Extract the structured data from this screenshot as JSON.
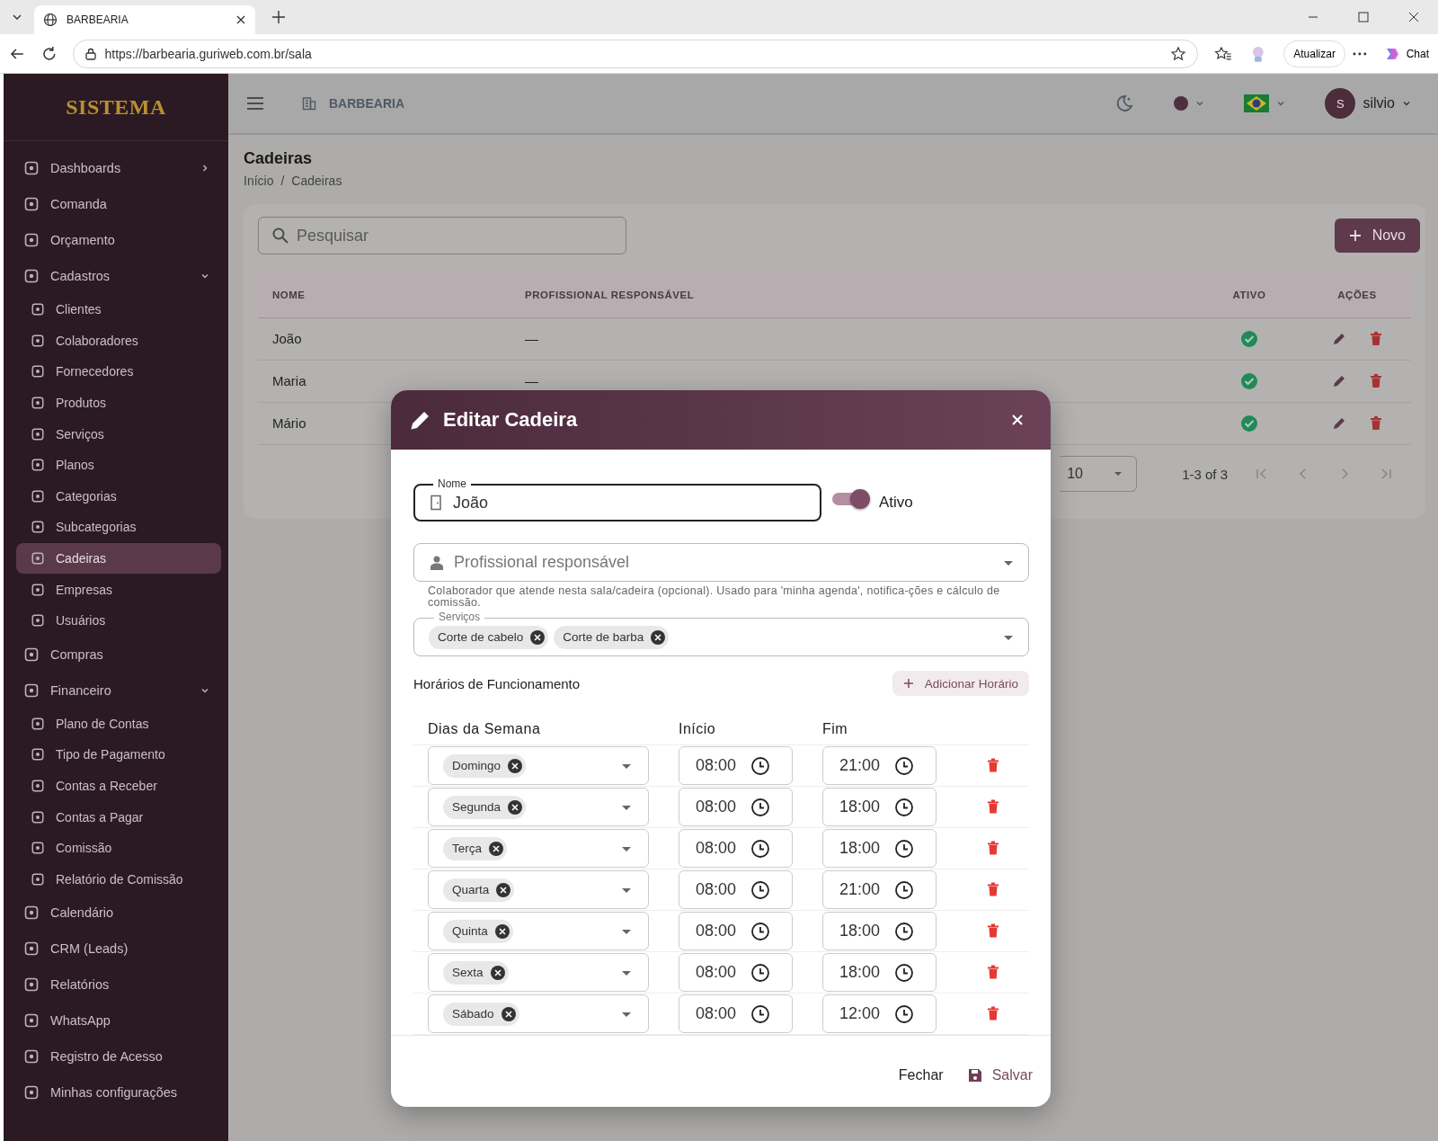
{
  "browser": {
    "tab_title": "BARBEARIA",
    "url": "https://barbearia.guriweb.com.br/sala",
    "update_button": "Atualizar",
    "chat_button": "Chat"
  },
  "app": {
    "logo": "SISTEMA",
    "company": "BARBEARIA",
    "user_initial": "S",
    "user_name": "silvio"
  },
  "sidebar": [
    {
      "label": "Dashboards",
      "selected": false,
      "expanded": false
    },
    {
      "label": "Comanda",
      "selected": false
    },
    {
      "label": "Orçamento",
      "selected": false
    },
    {
      "label": "Cadastros",
      "selected": false,
      "expanded": true,
      "children": [
        {
          "label": "Clientes",
          "selected": false
        },
        {
          "label": "Colaboradores",
          "selected": false
        },
        {
          "label": "Fornecedores",
          "selected": false
        },
        {
          "label": "Produtos",
          "selected": false
        },
        {
          "label": "Serviços",
          "selected": false
        },
        {
          "label": "Planos",
          "selected": false
        },
        {
          "label": "Categorias",
          "selected": false
        },
        {
          "label": "Subcategorias",
          "selected": false
        },
        {
          "label": "Cadeiras",
          "selected": true
        },
        {
          "label": "Empresas",
          "selected": false
        },
        {
          "label": "Usuários",
          "selected": false
        }
      ]
    },
    {
      "label": "Compras",
      "selected": false
    },
    {
      "label": "Financeiro",
      "selected": false,
      "expanded": true,
      "children": [
        {
          "label": "Plano de Contas",
          "selected": false
        },
        {
          "label": "Tipo de Pagamento",
          "selected": false
        },
        {
          "label": "Contas a Receber",
          "selected": false
        },
        {
          "label": "Contas a Pagar",
          "selected": false
        },
        {
          "label": "Comissão",
          "selected": false
        },
        {
          "label": "Relatório de Comissão",
          "selected": false
        }
      ]
    },
    {
      "label": "Calendário",
      "selected": false
    },
    {
      "label": "CRM (Leads)",
      "selected": false
    },
    {
      "label": "Relatórios",
      "selected": false
    },
    {
      "label": "WhatsApp",
      "selected": false
    },
    {
      "label": "Registro de Acesso",
      "selected": false
    },
    {
      "label": "Minhas configurações",
      "selected": false
    }
  ],
  "page": {
    "title": "Cadeiras",
    "breadcrumb": [
      "Início",
      "Cadeiras"
    ],
    "breadcrumb_separator": "/",
    "search_placeholder": "Pesquisar",
    "new_button": "Novo",
    "columns": [
      "NOME",
      "PROFISSIONAL RESPONSÁVEL",
      "ATIVO",
      "AÇÕES"
    ],
    "rows": [
      {
        "name": "João",
        "professional": "—",
        "active": true
      },
      {
        "name": "Maria",
        "professional": "—",
        "active": true
      },
      {
        "name": "Mário",
        "active": true
      }
    ],
    "pagination": {
      "per_page": "10",
      "range": "1-3 of 3"
    }
  },
  "modal": {
    "title": "Editar Cadeira",
    "name_label": "Nome",
    "name_value": "João",
    "active_label": "Ativo",
    "active": true,
    "professional_placeholder": "Profissional responsável",
    "helper": "Colaborador que atende nesta sala/cadeira (opcional). Usado para 'minha agenda', notifica-ções e cálculo de comissão.",
    "services_label": "Serviços",
    "services": [
      "Corte de cabelo",
      "Corte de barba"
    ],
    "schedule_title": "Horários de Funcionamento",
    "add_button": "Adicionar Horário",
    "schedule_columns": [
      "Dias da Semana",
      "Início",
      "Fim"
    ],
    "schedule": [
      {
        "day": "Domingo",
        "start": "08:00",
        "end": "21:00"
      },
      {
        "day": "Segunda",
        "start": "08:00",
        "end": "18:00"
      },
      {
        "day": "Terça",
        "start": "08:00",
        "end": "18:00"
      },
      {
        "day": "Quarta",
        "start": "08:00",
        "end": "21:00"
      },
      {
        "day": "Quinta",
        "start": "08:00",
        "end": "18:00"
      },
      {
        "day": "Sexta",
        "start": "08:00",
        "end": "18:00"
      },
      {
        "day": "Sábado",
        "start": "08:00",
        "end": "12:00"
      }
    ],
    "close_button": "Fechar",
    "save_button": "Salvar"
  }
}
